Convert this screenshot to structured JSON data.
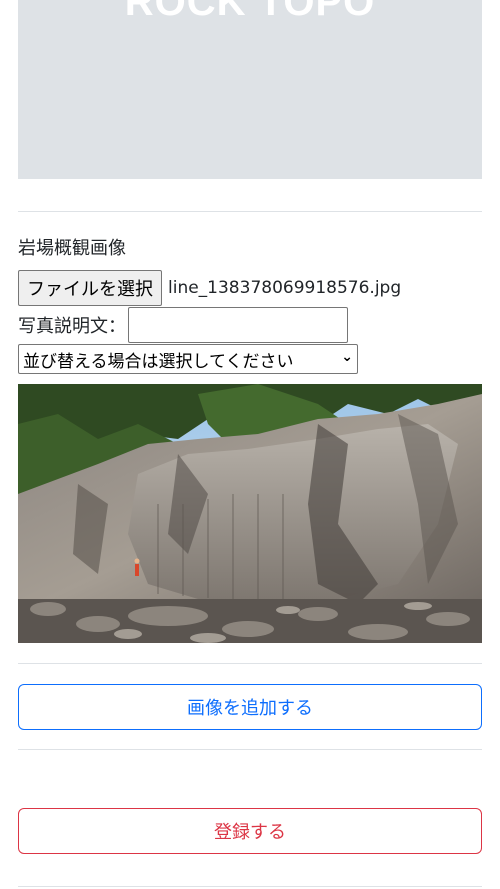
{
  "header": {
    "banner_title": "ROCK TOPO"
  },
  "form": {
    "section_label": "岩場概観画像",
    "file_button_label": "ファイルを選択",
    "file_name": "line_138378069918576.jpg",
    "description_label": "写真説明文：",
    "description_value": "",
    "sort_select_value": "並び替える場合は選択してください",
    "add_image_label": "画像を追加する",
    "submit_label": "登録する"
  },
  "colors": {
    "primary": "#0d6efd",
    "danger": "#dc3545",
    "banner_bg": "#dee2e6"
  },
  "icons": {
    "select_chevron": "chevron-down-icon"
  }
}
